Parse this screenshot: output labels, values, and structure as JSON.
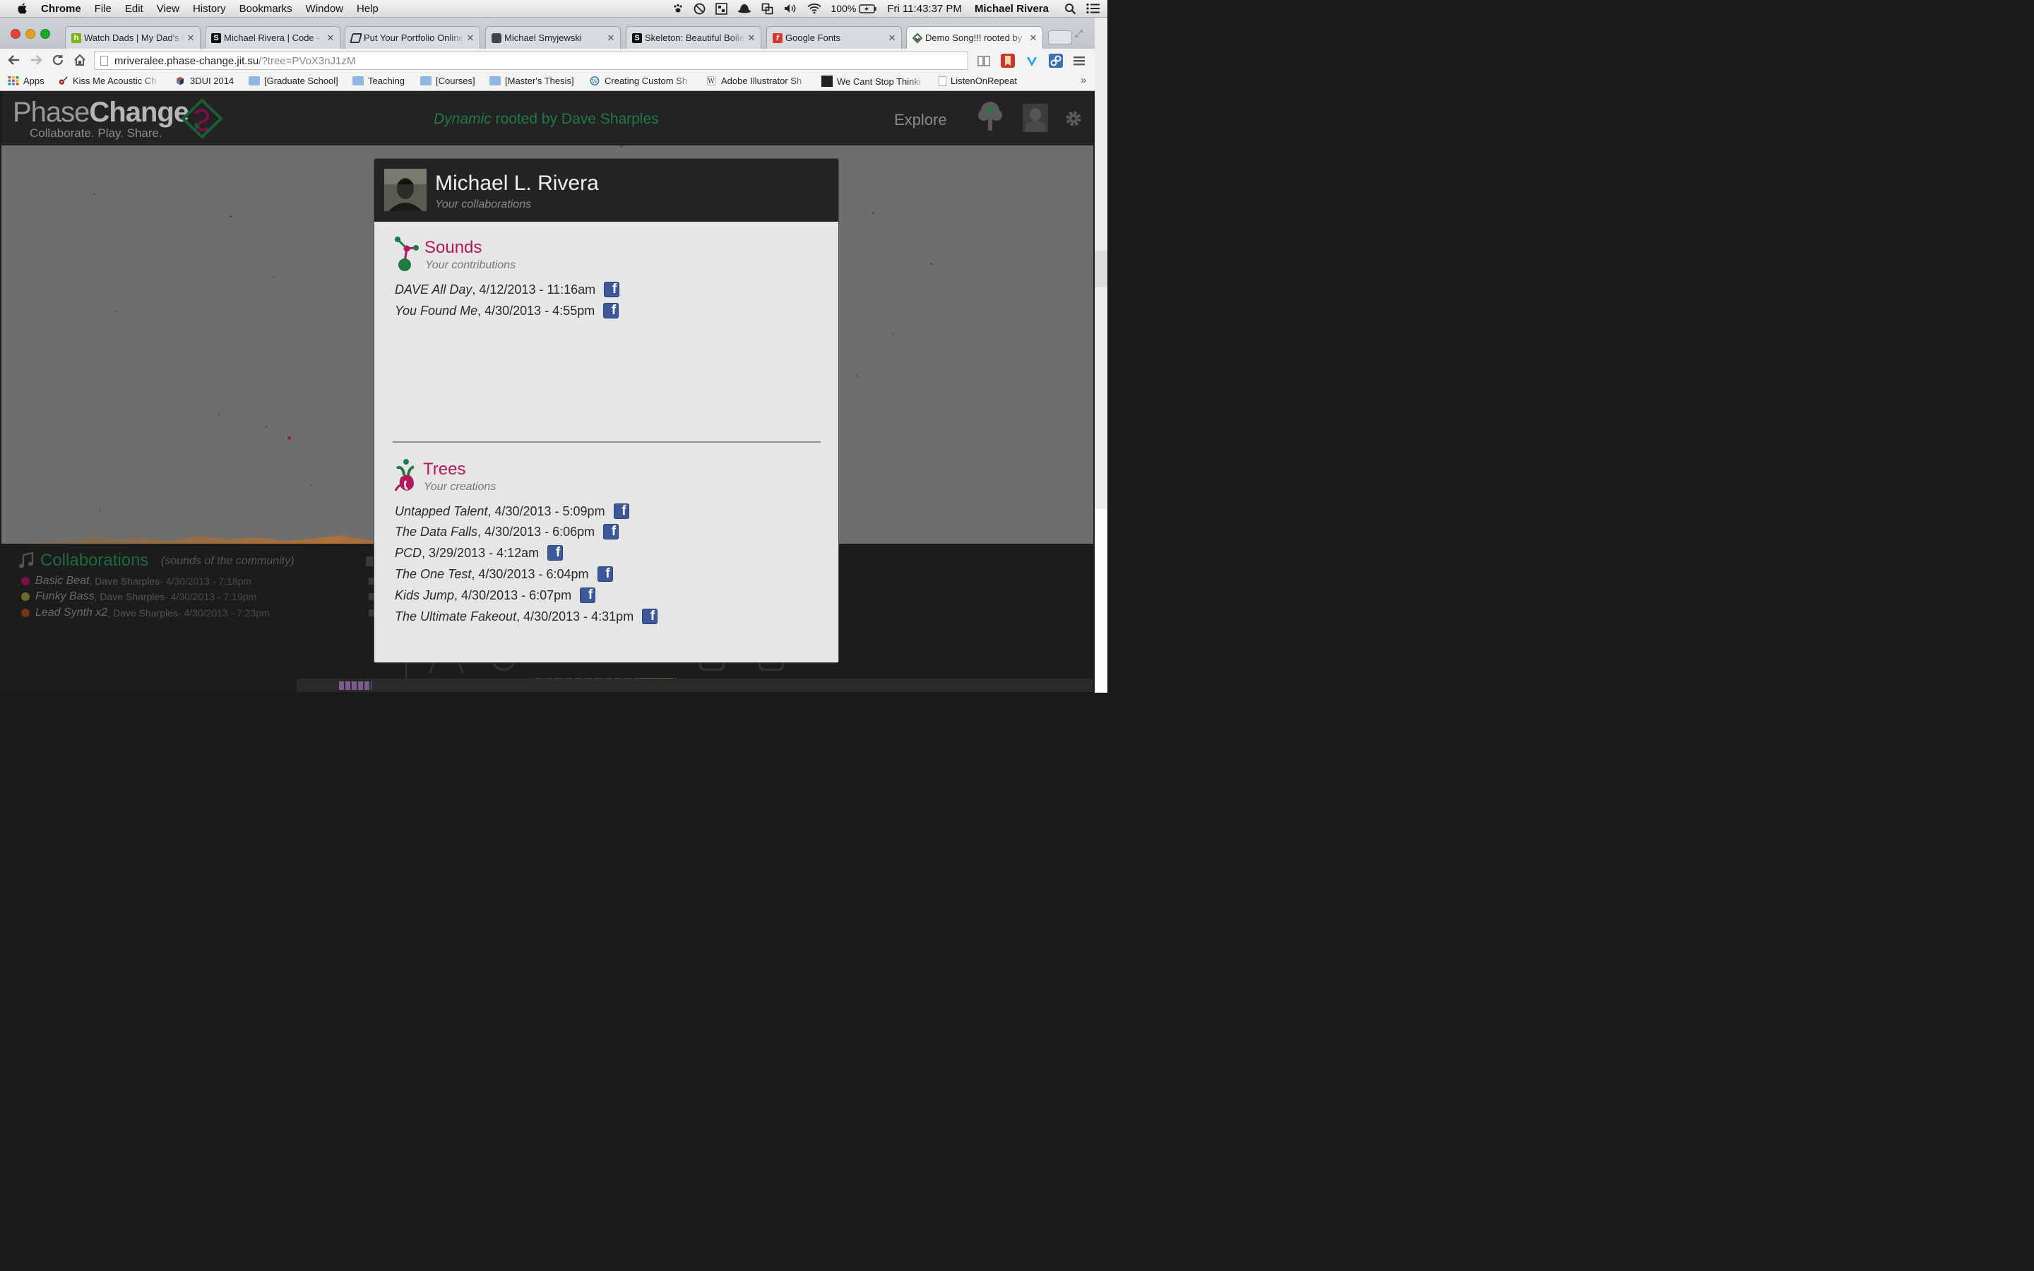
{
  "menubar": {
    "app": "Chrome",
    "items": [
      "File",
      "Edit",
      "View",
      "History",
      "Bookmarks",
      "Window",
      "Help"
    ],
    "battery": "100%",
    "clock": "Fri 11:43:37 PM",
    "user": "Michael Rivera"
  },
  "tabs": [
    {
      "title": "Watch Dads | My Dad's H",
      "favicon_color": "#7bb31a",
      "favicon_letter": "h"
    },
    {
      "title": "Michael Rivera | Code - ",
      "favicon_color": "#111111",
      "favicon_letter": "S"
    },
    {
      "title": "Put Your Portfolio Online",
      "favicon_color": "#333333",
      "favicon_letter": ""
    },
    {
      "title": "Michael Smyjewski",
      "favicon_color": "#444444",
      "favicon_letter": ""
    },
    {
      "title": "Skeleton: Beautiful Boile",
      "favicon_color": "#111111",
      "favicon_letter": "S"
    },
    {
      "title": "Google Fonts",
      "favicon_color": "#d23a2c",
      "favicon_letter": "f"
    },
    {
      "title": "Demo Song!!! rooted by",
      "favicon_color": "#b3175c",
      "favicon_letter": ""
    }
  ],
  "toolbar": {
    "url_host": "mriveralee.phase-change.jit.su",
    "url_path": "/?tree=PVoX3nJ1zM"
  },
  "bookmarks": [
    {
      "label": "Apps",
      "icon": "apps-grid-icon"
    },
    {
      "label": "Kiss Me Acoustic Ch",
      "icon": "guitar-icon"
    },
    {
      "label": "3DUI 2014",
      "icon": "cube-icon"
    },
    {
      "label": "[Graduate School]",
      "icon": "folder-icon"
    },
    {
      "label": "Teaching",
      "icon": "folder-icon"
    },
    {
      "label": "[Courses]",
      "icon": "folder-icon"
    },
    {
      "label": "[Master's Thesis]",
      "icon": "folder-icon"
    },
    {
      "label": "Creating Custom Sh",
      "icon": "wordpress-icon"
    },
    {
      "label": "Adobe Illustrator Sh",
      "icon": "w-icon"
    },
    {
      "label": "We Cant Stop Thinki",
      "icon": "black-square-icon"
    },
    {
      "label": "ListenOnRepeat",
      "icon": "page-icon"
    }
  ],
  "site": {
    "logo_light": "Phase",
    "logo_bold": "Change",
    "tagline": "Collaborate. Play. Share.",
    "song_italic": "Dynamic",
    "song_rest": " rooted by Dave Sharples",
    "explore": "Explore"
  },
  "collaborations": {
    "title": "Collaborations",
    "subtitle": "(sounds of the community)",
    "rows": [
      {
        "name": "Basic Beat",
        "who": ", Dave Sharples",
        "date": " - 4/30/2013 - 7:18pm",
        "color": "#7a1048"
      },
      {
        "name": "Funky Bass",
        "who": ", Dave Sharples",
        "date": " - 4/30/2013 - 7:19pm",
        "color": "#6f6a2a"
      },
      {
        "name": "Lead Synth x2",
        "who": ", Dave Sharples",
        "date": " - 4/30/2013 - 7:23pm",
        "color": "#7a3312"
      }
    ]
  },
  "modal": {
    "name": "Michael L. Rivera",
    "subtitle": "Your collaborations",
    "sounds": {
      "title": "Sounds",
      "subtitle": "Your contributions",
      "entries": [
        {
          "name": "DAVE All Day",
          "date": ", 4/12/2013 - 11:16am"
        },
        {
          "name": "You Found Me",
          "date": ", 4/30/2013 - 4:55pm"
        }
      ]
    },
    "trees": {
      "title": "Trees",
      "subtitle": "Your creations",
      "entries": [
        {
          "name": "Untapped Talent",
          "date": ", 4/30/2013 - 5:09pm"
        },
        {
          "name": "The Data Falls",
          "date": ", 4/30/2013 - 6:06pm"
        },
        {
          "name": "PCD",
          "date": ", 3/29/2013 - 4:12am"
        },
        {
          "name": "The One Test",
          "date": ", 4/30/2013 - 6:04pm"
        },
        {
          "name": "Kids Jump",
          "date": ", 4/30/2013 - 6:07pm"
        },
        {
          "name": "The Ultimate Fakeout",
          "date": ", 4/30/2013 - 4:31pm"
        }
      ]
    },
    "share_glyph": "f"
  },
  "colors": {
    "accent_magenta": "#b3175c",
    "accent_green": "#1f7a45",
    "facebook_blue": "#3b5998"
  }
}
